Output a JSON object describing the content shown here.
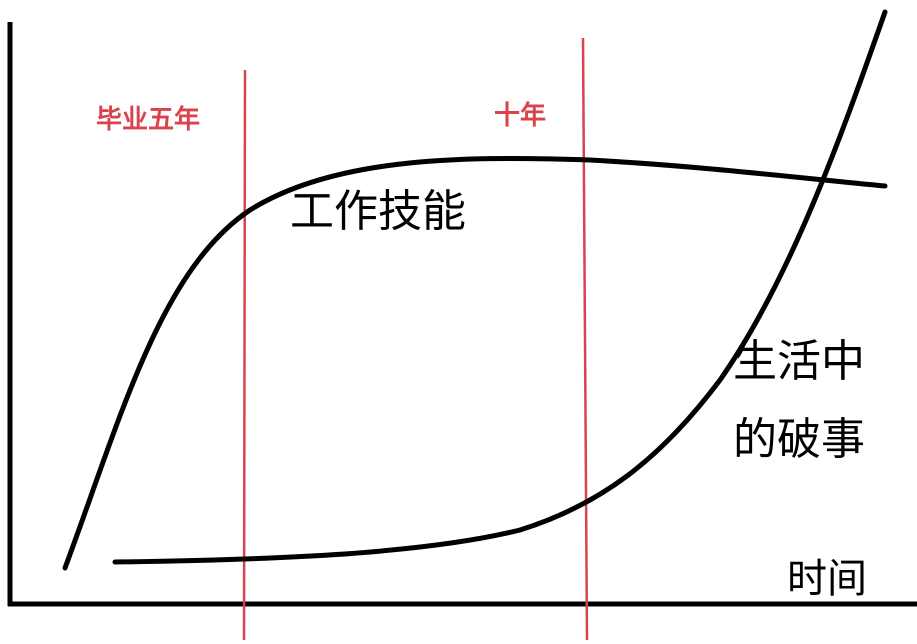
{
  "chart_data": {
    "type": "line",
    "title": "",
    "xlabel": "时间",
    "ylabel": "",
    "grid": false,
    "markers": [
      {
        "label": "毕业五年"
      },
      {
        "label": "十年"
      }
    ],
    "series": [
      {
        "name": "工作技能"
      },
      {
        "name_line1": "生活中",
        "name_line2": "的破事"
      }
    ]
  },
  "colors": {
    "axis": "#000000",
    "curve": "#000000",
    "marker": "#d9434b"
  }
}
